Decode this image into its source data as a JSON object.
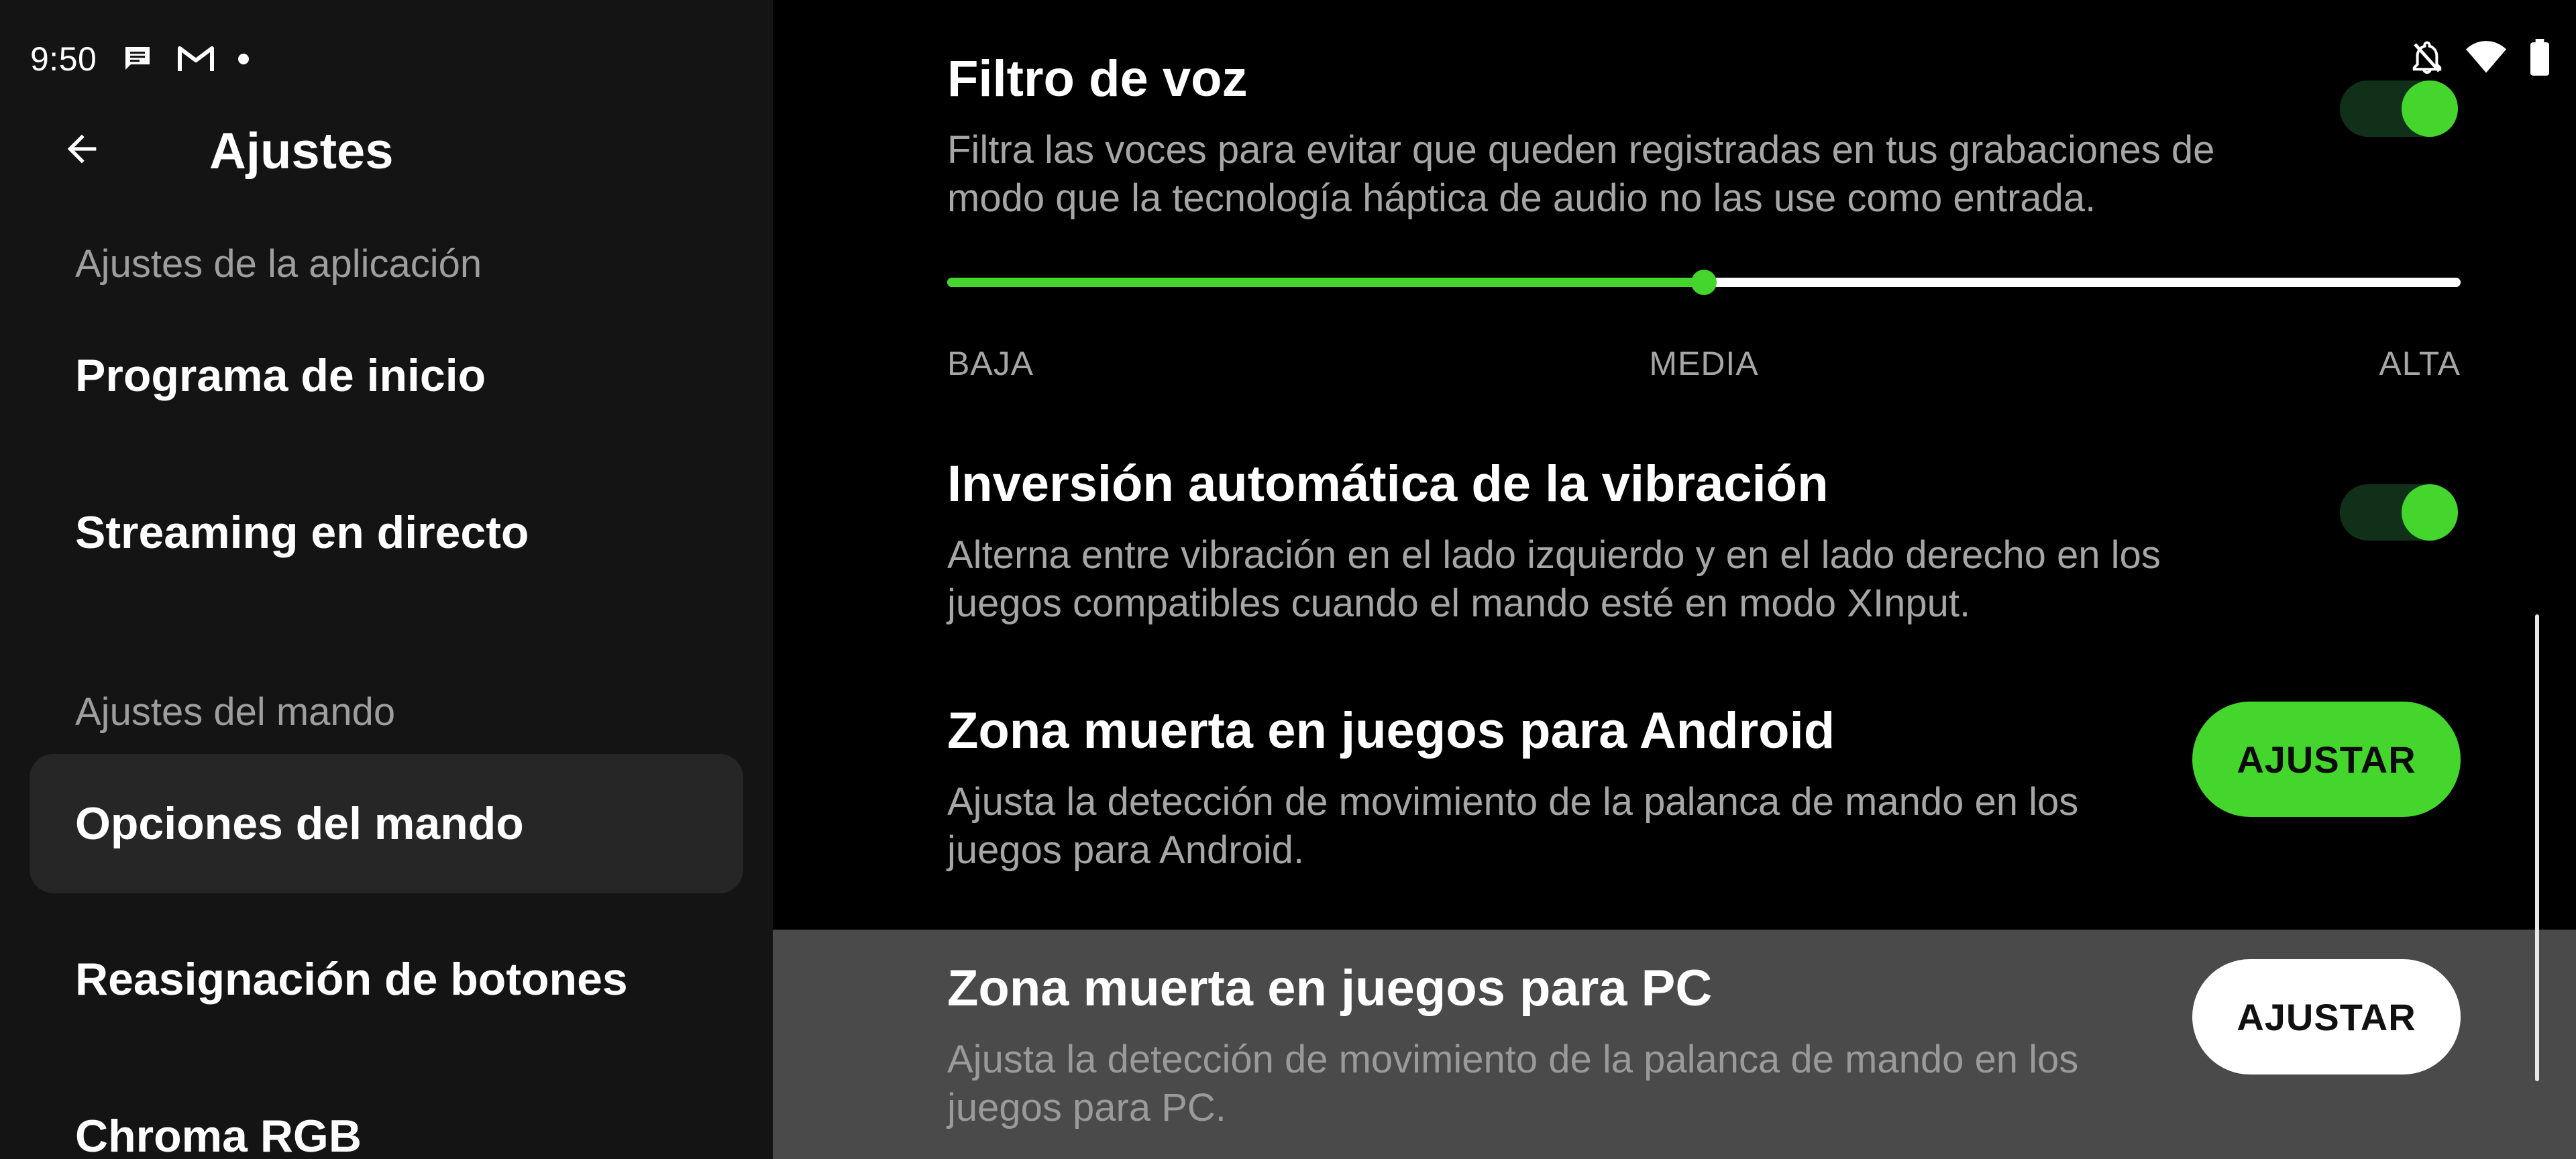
{
  "status_bar": {
    "time": "9:50",
    "left_icons": [
      "message-icon",
      "gmail-icon",
      "dot-icon"
    ],
    "right_icons": [
      "notifications-off-icon",
      "wifi-icon",
      "battery-icon"
    ]
  },
  "header": {
    "title": "Ajustes"
  },
  "sidebar": {
    "sections": [
      {
        "header": "Ajustes de la aplicación",
        "items": [
          {
            "label": "Programa de inicio",
            "selected": false
          },
          {
            "label": "Streaming en directo",
            "selected": false
          }
        ]
      },
      {
        "header": "Ajustes del mando",
        "items": [
          {
            "label": "Opciones del mando",
            "selected": true
          },
          {
            "label": "Reasignación de botones",
            "selected": false
          },
          {
            "label": "Chroma RGB",
            "selected": false
          }
        ]
      }
    ]
  },
  "settings": {
    "voice_filter": {
      "title": "Filtro de voz",
      "description": "Filtra las voces para evitar que queden registradas en tus grabaciones de modo que la tecnología háptica de audio no las use como entrada.",
      "enabled": true,
      "slider": {
        "value": 0.5,
        "labels": [
          "BAJA",
          "MEDIA",
          "ALTA"
        ]
      }
    },
    "auto_vibration": {
      "title": "Inversión automática de la vibración",
      "description": "Alterna entre vibración en el lado izquierdo y en el lado derecho en los juegos compatibles cuando el mando esté en modo XInput.",
      "enabled": true
    },
    "deadzone_android": {
      "title": "Zona muerta en juegos para Android",
      "description": "Ajusta la detección de movimiento de la palanca de mando en los juegos para Android.",
      "button": "AJUSTAR"
    },
    "deadzone_pc": {
      "title": "Zona muerta en juegos para PC",
      "description": "Ajusta la detección de movimiento de la palanca de mando en los juegos para PC.",
      "button": "AJUSTAR"
    }
  },
  "colors": {
    "accent": "#44d62c",
    "toggle_track_on": "#10301a",
    "highlight_bg": "#4a4a4a",
    "secondary_text": "#a6a6a6"
  }
}
